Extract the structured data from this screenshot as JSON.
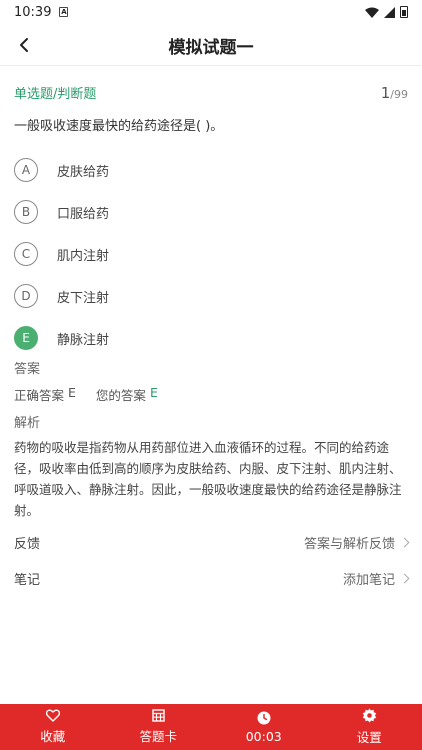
{
  "status": {
    "time": "10:39",
    "badge": "A"
  },
  "header": {
    "title": "模拟试题一"
  },
  "question": {
    "type": "单选题/判断题",
    "index": "1",
    "total": "/99",
    "text": "一般吸收速度最快的给药途径是( )。"
  },
  "options": [
    {
      "letter": "A",
      "text": "皮肤给药",
      "state": "normal"
    },
    {
      "letter": "B",
      "text": "口服给药",
      "state": "normal"
    },
    {
      "letter": "C",
      "text": "肌内注射",
      "state": "normal"
    },
    {
      "letter": "D",
      "text": "皮下注射",
      "state": "normal"
    },
    {
      "letter": "E",
      "text": "静脉注射",
      "state": "correct"
    }
  ],
  "answer": {
    "label": "答案",
    "correct_label": "正确答案",
    "correct_value": "E",
    "yours_label": "您的答案",
    "yours_value": "E"
  },
  "analysis": {
    "label": "解析",
    "text": "药物的吸收是指药物从用药部位进入血液循环的过程。不同的给药途径，吸收率由低到高的顺序为皮肤给药、内服、皮下注射、肌内注射、呼吸道吸入、静脉注射。因此，一般吸收速度最快的给药途径是静脉注射。"
  },
  "feedback": {
    "label": "反馈",
    "action": "答案与解析反馈"
  },
  "notes": {
    "label": "笔记",
    "action": "添加笔记"
  },
  "bottom_tabs": [
    {
      "label": "收藏",
      "icon": "heart-icon"
    },
    {
      "label": "答题卡",
      "icon": "answer-sheet-icon"
    },
    {
      "label": "00:03",
      "icon": "clock-icon"
    },
    {
      "label": "设置",
      "icon": "gear-icon"
    }
  ],
  "colors": {
    "accent_green": "#2a9d6b",
    "correct_fill": "#4caf72",
    "bottom_bar": "#e02a2a"
  }
}
